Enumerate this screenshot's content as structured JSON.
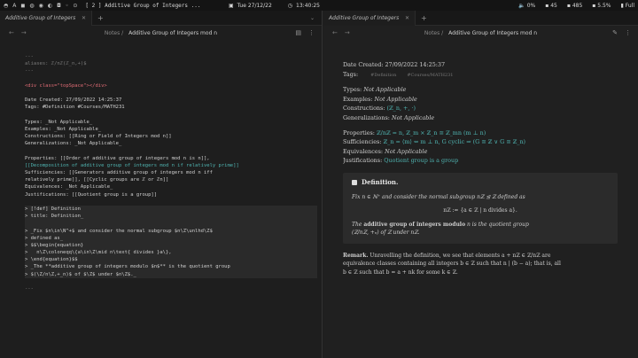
{
  "system_bar": {
    "workspaces": [
      "◓",
      "A",
      "◼",
      "◍",
      "◉",
      "◐",
      "◘",
      "◦",
      "⊙"
    ],
    "window_title": "[ 2 ] Additive Group of Integers ...",
    "date": "Tue 27/12/22",
    "time": "13:40:25",
    "status": [
      "0%",
      "45",
      "485",
      "5.5%",
      "Full"
    ]
  },
  "left_pane": {
    "tab_label": "Additive Group of Integers",
    "breadcrumb_parent": "Notes",
    "breadcrumb_current": "Additive Group of Integers mod n",
    "source_lines": [
      "---",
      "aliases: ℤ/nℤ(ℤ_n,+)$",
      "---",
      "",
      "<div class=\"topSpace\"></div>",
      "",
      "Date Created: 27/09/2022 14:25:37",
      "Tags: #Definition #Courses/MATH231",
      "",
      "Types: _Not Applicable_",
      "Examples: _Not Applicable_",
      "Constructions: [[Ring or Field of Integers mod n]]",
      "Generalizations: _Not Applicable_",
      "",
      "Properties: [[Order of additive group of integers mod n is n]],",
      "[[Decomposition of additive group of integers mod n if relatively prime]]",
      "Sufficiencies: [[Generators additive group of integers mod n iff",
      "relatively prime]], [[Cyclic groups are ℤ or ℤn]]",
      "Equivalences: _Not Applicable_",
      "Justifications: [[Quotient group is a group]]",
      "",
      "> [!def] Definition",
      "> title: Definition_",
      "",
      "> _Fix $n\\in\\N^+$ and consider the normal subgroup $n\\Z\\unlhd\\Z$",
      "> defined as_",
      "> $$\\begin{equation}",
      ">   n\\Z\\coloneqq\\{a\\in\\Z\\mid n\\text{ divides }a\\},",
      "> \\end{equation}$$",
      "> _The **additive group of integers modulo $n$** is the quotient group",
      "> $(\\Z/n\\Z,+_n)$ of $\\Z$ under $n\\Z$._",
      "",
      "---"
    ]
  },
  "right_pane": {
    "tab_label": "Additive Group of Integers",
    "breadcrumb_parent": "Notes",
    "breadcrumb_current": "Additive Group of Integers mod n",
    "date_created": "Date Created: 27/09/2022 14:25:37",
    "tags_label": "Tags:",
    "tags": [
      "#Definition",
      "#Courses/MATH231"
    ],
    "types_label": "Types:",
    "types_value": "Not Applicable",
    "examples_label": "Examples:",
    "examples_value": "Not Applicable",
    "constructions_label": "Constructions:",
    "constructions_value": "(ℤ_n, +, ·)",
    "generalizations_label": "Generalizations:",
    "generalizations_value": "Not Applicable",
    "properties_label": "Properties:",
    "properties_value": "ℤ/nℤ = n, ℤ_m × ℤ_n ≅ ℤ_mn (m ⊥ n)",
    "sufficiencies_label": "Sufficiencies:",
    "sufficiencies_value": "ℤ_n = ⟨m⟩ ⇔ m ⊥ n, G cyclic ⇒ (G ≅ ℤ ∨ G ≅ ℤ_n)",
    "equivalences_label": "Equivalences:",
    "equivalences_value": "Not Applicable",
    "justifications_label": "Justifications:",
    "justifications_value": "Quotient group is a group",
    "callout_title": "Definition.",
    "callout_p1": "Fix n ∈ ℕ⁺ and consider the normal subgroup nℤ ⊴ ℤ defined as",
    "callout_eq": "nℤ := {a ∈ ℤ | n divides a}.",
    "callout_p2_pre": "The",
    "callout_p2_bold": "additive group of integers modulo",
    "callout_p2_post": "n is the quotient group",
    "callout_p3": "(ℤ/nℤ, +ₙ) of ℤ under nℤ.",
    "remark_label": "Remark.",
    "remark_l1": "Unravelling the definition, we see that elements a + nℤ ∈ ℤ/nℤ are",
    "remark_l2": "equivalence classes containing all integers b ∈ ℤ such that n | (b − a); that is, all",
    "remark_l3": "b ∈ ℤ such that b = a + nk for some k ∈ ℤ."
  }
}
